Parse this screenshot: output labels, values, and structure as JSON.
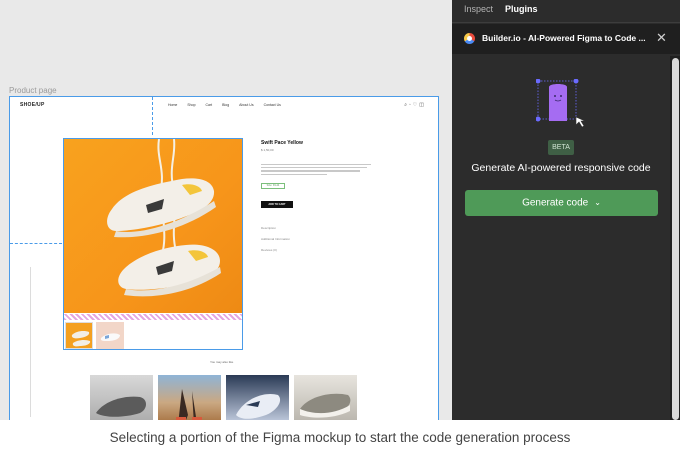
{
  "canvas": {
    "frame_label": "Product page",
    "site": {
      "logo": "SHOE/UP",
      "nav": [
        "Home",
        "Shop",
        "Cart",
        "Blog",
        "About Us",
        "Contact Us"
      ],
      "product_name": "Swift Pace Yellow",
      "product_sub": "$ 1,50,00",
      "size_label": "Size: 39-44",
      "cart_button": "ADD TO CART",
      "meta": [
        "Description",
        "Additional Information",
        "Reviews (0)"
      ],
      "like_label": "You may also like"
    }
  },
  "panel": {
    "tabs": [
      "Inspect",
      "Plugins"
    ],
    "plugin_title": "Builder.io - AI-Powered Figma to Code ...",
    "beta": "BETA",
    "headline": "Generate AI-powered responsive code",
    "generate_button": "Generate code"
  },
  "caption": "Selecting a portion of the Figma mockup to start the code generation process",
  "colors": {
    "panel_bg": "#2c2c2c",
    "accent_green": "#4f9a58",
    "selection_blue": "#4a9be8",
    "hero_orange": "#f7951a"
  }
}
